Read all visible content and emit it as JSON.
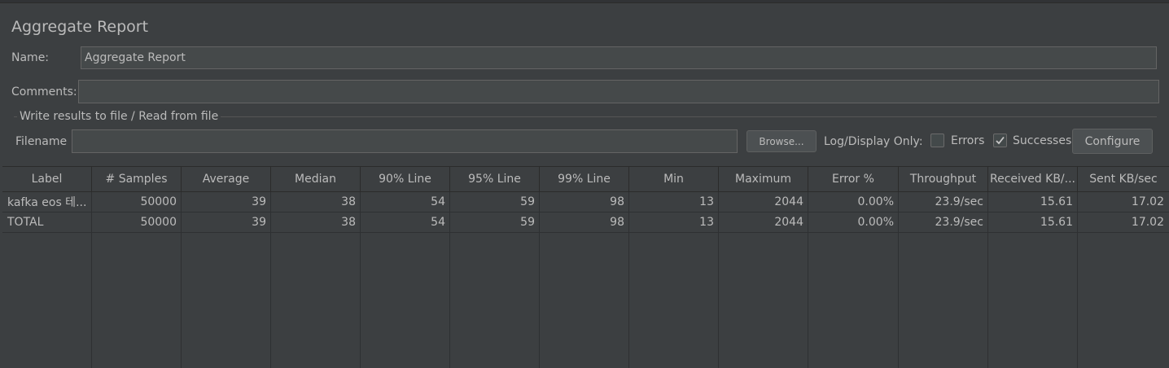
{
  "panel": {
    "title": "Aggregate Report"
  },
  "name_field": {
    "label": "Name:",
    "value": "Aggregate Report"
  },
  "comments_field": {
    "label": "Comments:",
    "value": ""
  },
  "file_group": {
    "title": "Write results to file / Read from file",
    "filename_label": "Filename",
    "filename_value": "",
    "browse_label": "Browse...",
    "log_display_label": "Log/Display Only:",
    "errors_label": "Errors",
    "errors_checked": false,
    "successes_label": "Successes",
    "successes_checked": true,
    "configure_label": "Configure"
  },
  "table": {
    "columns": [
      "Label",
      "# Samples",
      "Average",
      "Median",
      "90% Line",
      "95% Line",
      "99% Line",
      "Min",
      "Maximum",
      "Error %",
      "Throughput",
      "Received KB/...",
      "Sent KB/sec"
    ],
    "rows": [
      [
        "kafka eos 테...",
        "50000",
        "39",
        "38",
        "54",
        "59",
        "98",
        "13",
        "2044",
        "0.00%",
        "23.9/sec",
        "15.61",
        "17.02"
      ],
      [
        "TOTAL",
        "50000",
        "39",
        "38",
        "54",
        "59",
        "98",
        "13",
        "2044",
        "0.00%",
        "23.9/sec",
        "15.61",
        "17.02"
      ]
    ]
  },
  "colors": {
    "background": "#3c3f41",
    "field_background": "#45494a",
    "text": "#bbbbbb",
    "grid": "#2e3032"
  }
}
